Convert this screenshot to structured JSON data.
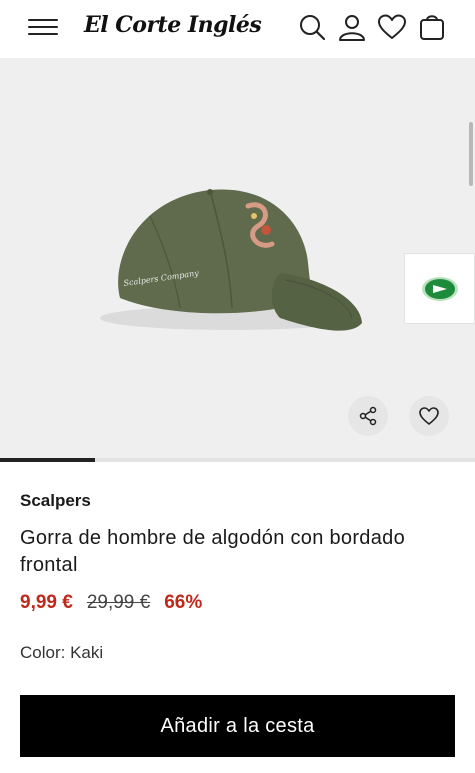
{
  "header": {
    "logo_text": "El Corte Inglés",
    "icons": [
      "menu-icon",
      "search-icon",
      "user-icon",
      "heart-icon",
      "bag-icon"
    ]
  },
  "gallery": {
    "image_alt": "cap-product-image",
    "cap_color": "#5f6b4c",
    "progress_fraction": 0.2,
    "share_icon": "share-icon",
    "wishlist_icon": "heart-icon",
    "feature_icon": "green-play-badge-icon"
  },
  "product": {
    "brand": "Scalpers",
    "title": "Gorra de hombre de algodón con bordado frontal",
    "price_now": "9,99 €",
    "price_old": "29,99 €",
    "discount": "66%",
    "color_label": "Color: Kaki"
  },
  "actions": {
    "add_to_cart": "Añadir a la cesta"
  },
  "colors": {
    "accent_price": "#c0281a",
    "button_bg": "#000000",
    "badge_green": "#1e8a3c"
  }
}
